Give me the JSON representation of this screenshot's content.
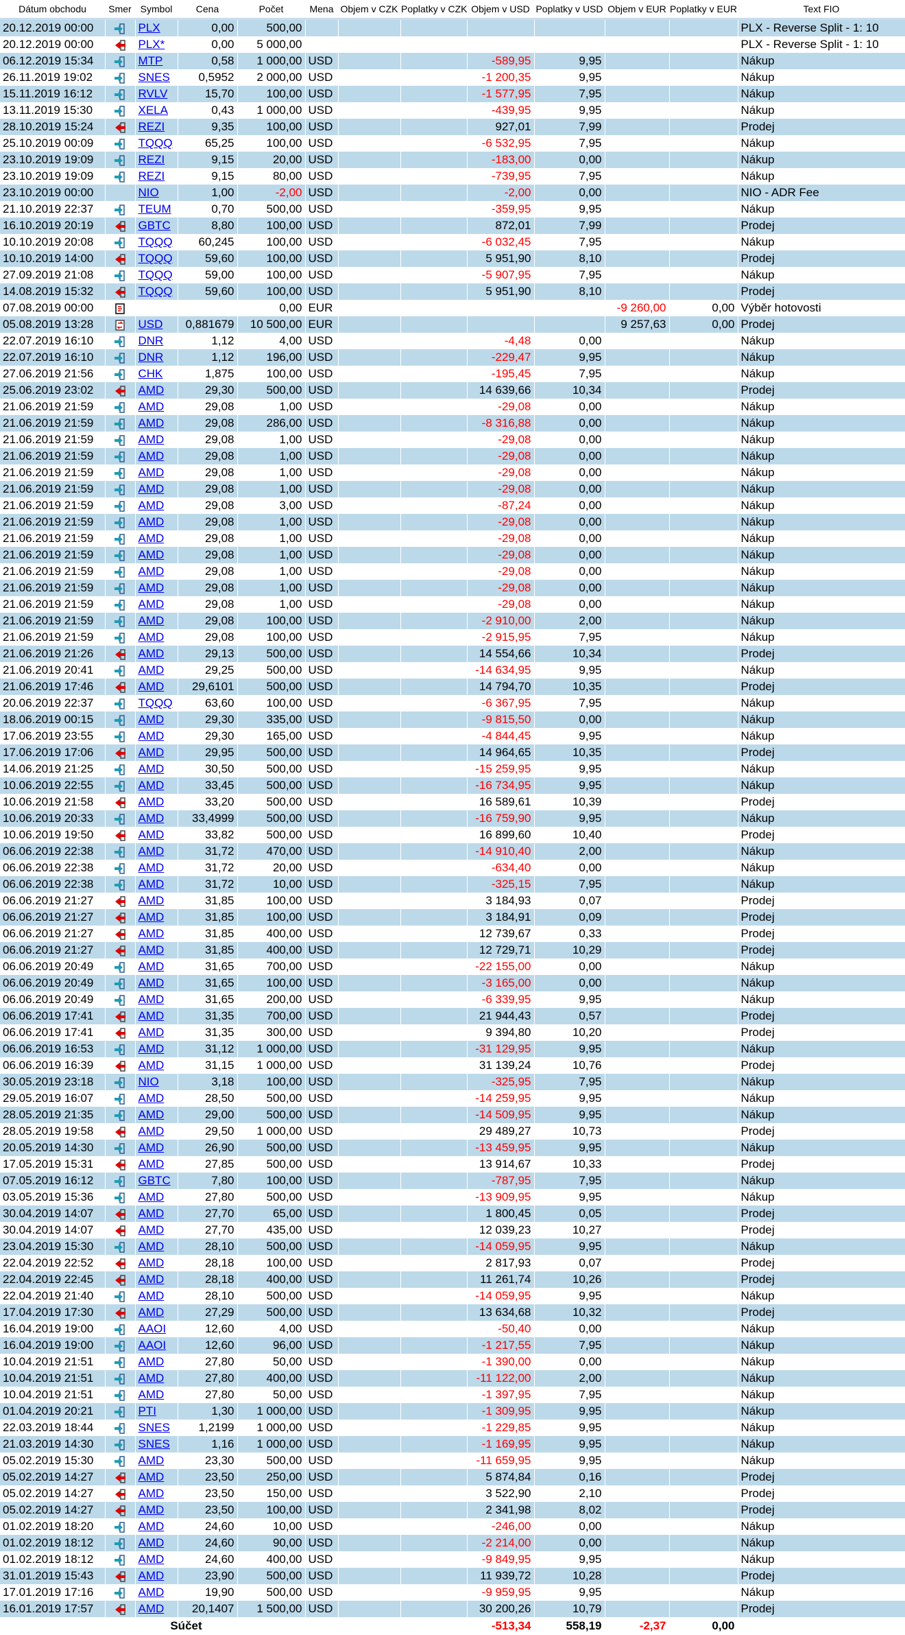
{
  "columns": [
    "Dátum obchodu",
    "Smer",
    "Symbol",
    "Cena",
    "Počet",
    "Mena",
    "Objem v CZK",
    "Poplatky v CZK",
    "Objem v USD",
    "Poplatky v USD",
    "Objem v EUR",
    "Poplatky v EUR",
    "Text FIO"
  ],
  "colors": {
    "row_stripe": "#bcd9ea",
    "negative": "#ff0000",
    "link": "#0000ee",
    "buy_icon": "#1f9bb5",
    "sell_icon": "#e00000"
  },
  "icons": {
    "buy": "arrow-in-icon",
    "sell": "arrow-out-icon",
    "withdraw": "withdrawal-icon",
    "fx": "currency-exchange-icon"
  },
  "rows": [
    [
      "20.12.2019 00:00",
      "buy",
      "PLX",
      "0,00",
      "500,00",
      "",
      "",
      "",
      "",
      "",
      "",
      "",
      "PLX - Reverse Split - 1: 10"
    ],
    [
      "20.12.2019 00:00",
      "sell",
      "PLX*",
      "0,00",
      "5 000,00",
      "",
      "",
      "",
      "",
      "",
      "",
      "",
      "PLX - Reverse Split - 1: 10"
    ],
    [
      "06.12.2019 15:34",
      "buy",
      "MTP",
      "0,58",
      "1 000,00",
      "USD",
      "",
      "",
      "-589,95",
      "9,95",
      "",
      "",
      "Nákup"
    ],
    [
      "26.11.2019 19:02",
      "buy",
      "SNES",
      "0,5952",
      "2 000,00",
      "USD",
      "",
      "",
      "-1 200,35",
      "9,95",
      "",
      "",
      "Nákup"
    ],
    [
      "15.11.2019 16:12",
      "buy",
      "RVLV",
      "15,70",
      "100,00",
      "USD",
      "",
      "",
      "-1 577,95",
      "7,95",
      "",
      "",
      "Nákup"
    ],
    [
      "13.11.2019 15:30",
      "buy",
      "XELA",
      "0,43",
      "1 000,00",
      "USD",
      "",
      "",
      "-439,95",
      "9,95",
      "",
      "",
      "Nákup"
    ],
    [
      "28.10.2019 15:24",
      "sell",
      "REZI",
      "9,35",
      "100,00",
      "USD",
      "",
      "",
      "927,01",
      "7,99",
      "",
      "",
      "Prodej"
    ],
    [
      "25.10.2019 00:09",
      "buy",
      "TQQQ",
      "65,25",
      "100,00",
      "USD",
      "",
      "",
      "-6 532,95",
      "7,95",
      "",
      "",
      "Nákup"
    ],
    [
      "23.10.2019 19:09",
      "buy",
      "REZI",
      "9,15",
      "20,00",
      "USD",
      "",
      "",
      "-183,00",
      "0,00",
      "",
      "",
      "Nákup"
    ],
    [
      "23.10.2019 19:09",
      "buy",
      "REZI",
      "9,15",
      "80,00",
      "USD",
      "",
      "",
      "-739,95",
      "7,95",
      "",
      "",
      "Nákup"
    ],
    [
      "23.10.2019 00:00",
      "",
      "NIO",
      "1,00",
      "-2,00",
      "USD",
      "",
      "",
      "-2,00",
      "0,00",
      "",
      "",
      "NIO - ADR Fee"
    ],
    [
      "21.10.2019 22:37",
      "buy",
      "TEUM",
      "0,70",
      "500,00",
      "USD",
      "",
      "",
      "-359,95",
      "9,95",
      "",
      "",
      "Nákup"
    ],
    [
      "16.10.2019 20:19",
      "sell",
      "GBTC",
      "8,80",
      "100,00",
      "USD",
      "",
      "",
      "872,01",
      "7,99",
      "",
      "",
      "Prodej"
    ],
    [
      "10.10.2019 20:08",
      "buy",
      "TQQQ",
      "60,245",
      "100,00",
      "USD",
      "",
      "",
      "-6 032,45",
      "7,95",
      "",
      "",
      "Nákup"
    ],
    [
      "10.10.2019 14:00",
      "sell",
      "TQQQ",
      "59,60",
      "100,00",
      "USD",
      "",
      "",
      "5 951,90",
      "8,10",
      "",
      "",
      "Prodej"
    ],
    [
      "27.09.2019 21:08",
      "buy",
      "TQQQ",
      "59,00",
      "100,00",
      "USD",
      "",
      "",
      "-5 907,95",
      "7,95",
      "",
      "",
      "Nákup"
    ],
    [
      "14.08.2019 15:32",
      "sell",
      "TQQQ",
      "59,60",
      "100,00",
      "USD",
      "",
      "",
      "5 951,90",
      "8,10",
      "",
      "",
      "Prodej"
    ],
    [
      "07.08.2019 00:00",
      "withdraw",
      "",
      "",
      "0,00",
      "EUR",
      "",
      "",
      "",
      "",
      "-9 260,00",
      "0,00",
      "Výběr hotovosti"
    ],
    [
      "05.08.2019 13:28",
      "fx",
      "USD",
      "0,881679",
      "10 500,00",
      "EUR",
      "",
      "",
      "",
      "",
      "9 257,63",
      "0,00",
      "Prodej"
    ],
    [
      "22.07.2019 16:10",
      "buy",
      "DNR",
      "1,12",
      "4,00",
      "USD",
      "",
      "",
      "-4,48",
      "0,00",
      "",
      "",
      "Nákup"
    ],
    [
      "22.07.2019 16:10",
      "buy",
      "DNR",
      "1,12",
      "196,00",
      "USD",
      "",
      "",
      "-229,47",
      "9,95",
      "",
      "",
      "Nákup"
    ],
    [
      "27.06.2019 21:56",
      "buy",
      "CHK",
      "1,875",
      "100,00",
      "USD",
      "",
      "",
      "-195,45",
      "7,95",
      "",
      "",
      "Nákup"
    ],
    [
      "25.06.2019 23:02",
      "sell",
      "AMD",
      "29,30",
      "500,00",
      "USD",
      "",
      "",
      "14 639,66",
      "10,34",
      "",
      "",
      "Prodej"
    ],
    [
      "21.06.2019 21:59",
      "buy",
      "AMD",
      "29,08",
      "1,00",
      "USD",
      "",
      "",
      "-29,08",
      "0,00",
      "",
      "",
      "Nákup"
    ],
    [
      "21.06.2019 21:59",
      "buy",
      "AMD",
      "29,08",
      "286,00",
      "USD",
      "",
      "",
      "-8 316,88",
      "0,00",
      "",
      "",
      "Nákup"
    ],
    [
      "21.06.2019 21:59",
      "buy",
      "AMD",
      "29,08",
      "1,00",
      "USD",
      "",
      "",
      "-29,08",
      "0,00",
      "",
      "",
      "Nákup"
    ],
    [
      "21.06.2019 21:59",
      "buy",
      "AMD",
      "29,08",
      "1,00",
      "USD",
      "",
      "",
      "-29,08",
      "0,00",
      "",
      "",
      "Nákup"
    ],
    [
      "21.06.2019 21:59",
      "buy",
      "AMD",
      "29,08",
      "1,00",
      "USD",
      "",
      "",
      "-29,08",
      "0,00",
      "",
      "",
      "Nákup"
    ],
    [
      "21.06.2019 21:59",
      "buy",
      "AMD",
      "29,08",
      "1,00",
      "USD",
      "",
      "",
      "-29,08",
      "0,00",
      "",
      "",
      "Nákup"
    ],
    [
      "21.06.2019 21:59",
      "buy",
      "AMD",
      "29,08",
      "3,00",
      "USD",
      "",
      "",
      "-87,24",
      "0,00",
      "",
      "",
      "Nákup"
    ],
    [
      "21.06.2019 21:59",
      "buy",
      "AMD",
      "29,08",
      "1,00",
      "USD",
      "",
      "",
      "-29,08",
      "0,00",
      "",
      "",
      "Nákup"
    ],
    [
      "21.06.2019 21:59",
      "buy",
      "AMD",
      "29,08",
      "1,00",
      "USD",
      "",
      "",
      "-29,08",
      "0,00",
      "",
      "",
      "Nákup"
    ],
    [
      "21.06.2019 21:59",
      "buy",
      "AMD",
      "29,08",
      "1,00",
      "USD",
      "",
      "",
      "-29,08",
      "0,00",
      "",
      "",
      "Nákup"
    ],
    [
      "21.06.2019 21:59",
      "buy",
      "AMD",
      "29,08",
      "1,00",
      "USD",
      "",
      "",
      "-29,08",
      "0,00",
      "",
      "",
      "Nákup"
    ],
    [
      "21.06.2019 21:59",
      "buy",
      "AMD",
      "29,08",
      "1,00",
      "USD",
      "",
      "",
      "-29,08",
      "0,00",
      "",
      "",
      "Nákup"
    ],
    [
      "21.06.2019 21:59",
      "buy",
      "AMD",
      "29,08",
      "1,00",
      "USD",
      "",
      "",
      "-29,08",
      "0,00",
      "",
      "",
      "Nákup"
    ],
    [
      "21.06.2019 21:59",
      "buy",
      "AMD",
      "29,08",
      "100,00",
      "USD",
      "",
      "",
      "-2 910,00",
      "2,00",
      "",
      "",
      "Nákup"
    ],
    [
      "21.06.2019 21:59",
      "buy",
      "AMD",
      "29,08",
      "100,00",
      "USD",
      "",
      "",
      "-2 915,95",
      "7,95",
      "",
      "",
      "Nákup"
    ],
    [
      "21.06.2019 21:26",
      "sell",
      "AMD",
      "29,13",
      "500,00",
      "USD",
      "",
      "",
      "14 554,66",
      "10,34",
      "",
      "",
      "Prodej"
    ],
    [
      "21.06.2019 20:41",
      "buy",
      "AMD",
      "29,25",
      "500,00",
      "USD",
      "",
      "",
      "-14 634,95",
      "9,95",
      "",
      "",
      "Nákup"
    ],
    [
      "21.06.2019 17:46",
      "sell",
      "AMD",
      "29,6101",
      "500,00",
      "USD",
      "",
      "",
      "14 794,70",
      "10,35",
      "",
      "",
      "Prodej"
    ],
    [
      "20.06.2019 22:37",
      "buy",
      "TQQQ",
      "63,60",
      "100,00",
      "USD",
      "",
      "",
      "-6 367,95",
      "7,95",
      "",
      "",
      "Nákup"
    ],
    [
      "18.06.2019 00:15",
      "buy",
      "AMD",
      "29,30",
      "335,00",
      "USD",
      "",
      "",
      "-9 815,50",
      "0,00",
      "",
      "",
      "Nákup"
    ],
    [
      "17.06.2019 23:55",
      "buy",
      "AMD",
      "29,30",
      "165,00",
      "USD",
      "",
      "",
      "-4 844,45",
      "9,95",
      "",
      "",
      "Nákup"
    ],
    [
      "17.06.2019 17:06",
      "sell",
      "AMD",
      "29,95",
      "500,00",
      "USD",
      "",
      "",
      "14 964,65",
      "10,35",
      "",
      "",
      "Prodej"
    ],
    [
      "14.06.2019 21:25",
      "buy",
      "AMD",
      "30,50",
      "500,00",
      "USD",
      "",
      "",
      "-15 259,95",
      "9,95",
      "",
      "",
      "Nákup"
    ],
    [
      "10.06.2019 22:55",
      "buy",
      "AMD",
      "33,45",
      "500,00",
      "USD",
      "",
      "",
      "-16 734,95",
      "9,95",
      "",
      "",
      "Nákup"
    ],
    [
      "10.06.2019 21:58",
      "sell",
      "AMD",
      "33,20",
      "500,00",
      "USD",
      "",
      "",
      "16 589,61",
      "10,39",
      "",
      "",
      "Prodej"
    ],
    [
      "10.06.2019 20:33",
      "buy",
      "AMD",
      "33,4999",
      "500,00",
      "USD",
      "",
      "",
      "-16 759,90",
      "9,95",
      "",
      "",
      "Nákup"
    ],
    [
      "10.06.2019 19:50",
      "sell",
      "AMD",
      "33,82",
      "500,00",
      "USD",
      "",
      "",
      "16 899,60",
      "10,40",
      "",
      "",
      "Prodej"
    ],
    [
      "06.06.2019 22:38",
      "buy",
      "AMD",
      "31,72",
      "470,00",
      "USD",
      "",
      "",
      "-14 910,40",
      "2,00",
      "",
      "",
      "Nákup"
    ],
    [
      "06.06.2019 22:38",
      "buy",
      "AMD",
      "31,72",
      "20,00",
      "USD",
      "",
      "",
      "-634,40",
      "0,00",
      "",
      "",
      "Nákup"
    ],
    [
      "06.06.2019 22:38",
      "buy",
      "AMD",
      "31,72",
      "10,00",
      "USD",
      "",
      "",
      "-325,15",
      "7,95",
      "",
      "",
      "Nákup"
    ],
    [
      "06.06.2019 21:27",
      "sell",
      "AMD",
      "31,85",
      "100,00",
      "USD",
      "",
      "",
      "3 184,93",
      "0,07",
      "",
      "",
      "Prodej"
    ],
    [
      "06.06.2019 21:27",
      "sell",
      "AMD",
      "31,85",
      "100,00",
      "USD",
      "",
      "",
      "3 184,91",
      "0,09",
      "",
      "",
      "Prodej"
    ],
    [
      "06.06.2019 21:27",
      "sell",
      "AMD",
      "31,85",
      "400,00",
      "USD",
      "",
      "",
      "12 739,67",
      "0,33",
      "",
      "",
      "Prodej"
    ],
    [
      "06.06.2019 21:27",
      "sell",
      "AMD",
      "31,85",
      "400,00",
      "USD",
      "",
      "",
      "12 729,71",
      "10,29",
      "",
      "",
      "Prodej"
    ],
    [
      "06.06.2019 20:49",
      "buy",
      "AMD",
      "31,65",
      "700,00",
      "USD",
      "",
      "",
      "-22 155,00",
      "0,00",
      "",
      "",
      "Nákup"
    ],
    [
      "06.06.2019 20:49",
      "buy",
      "AMD",
      "31,65",
      "100,00",
      "USD",
      "",
      "",
      "-3 165,00",
      "0,00",
      "",
      "",
      "Nákup"
    ],
    [
      "06.06.2019 20:49",
      "buy",
      "AMD",
      "31,65",
      "200,00",
      "USD",
      "",
      "",
      "-6 339,95",
      "9,95",
      "",
      "",
      "Nákup"
    ],
    [
      "06.06.2019 17:41",
      "sell",
      "AMD",
      "31,35",
      "700,00",
      "USD",
      "",
      "",
      "21 944,43",
      "0,57",
      "",
      "",
      "Prodej"
    ],
    [
      "06.06.2019 17:41",
      "sell",
      "AMD",
      "31,35",
      "300,00",
      "USD",
      "",
      "",
      "9 394,80",
      "10,20",
      "",
      "",
      "Prodej"
    ],
    [
      "06.06.2019 16:53",
      "buy",
      "AMD",
      "31,12",
      "1 000,00",
      "USD",
      "",
      "",
      "-31 129,95",
      "9,95",
      "",
      "",
      "Nákup"
    ],
    [
      "06.06.2019 16:39",
      "sell",
      "AMD",
      "31,15",
      "1 000,00",
      "USD",
      "",
      "",
      "31 139,24",
      "10,76",
      "",
      "",
      "Prodej"
    ],
    [
      "30.05.2019 23:18",
      "buy",
      "NIO",
      "3,18",
      "100,00",
      "USD",
      "",
      "",
      "-325,95",
      "7,95",
      "",
      "",
      "Nákup"
    ],
    [
      "29.05.2019 16:07",
      "buy",
      "AMD",
      "28,50",
      "500,00",
      "USD",
      "",
      "",
      "-14 259,95",
      "9,95",
      "",
      "",
      "Nákup"
    ],
    [
      "28.05.2019 21:35",
      "buy",
      "AMD",
      "29,00",
      "500,00",
      "USD",
      "",
      "",
      "-14 509,95",
      "9,95",
      "",
      "",
      "Nákup"
    ],
    [
      "28.05.2019 19:58",
      "sell",
      "AMD",
      "29,50",
      "1 000,00",
      "USD",
      "",
      "",
      "29 489,27",
      "10,73",
      "",
      "",
      "Prodej"
    ],
    [
      "20.05.2019 14:30",
      "buy",
      "AMD",
      "26,90",
      "500,00",
      "USD",
      "",
      "",
      "-13 459,95",
      "9,95",
      "",
      "",
      "Nákup"
    ],
    [
      "17.05.2019 15:31",
      "sell",
      "AMD",
      "27,85",
      "500,00",
      "USD",
      "",
      "",
      "13 914,67",
      "10,33",
      "",
      "",
      "Prodej"
    ],
    [
      "07.05.2019 16:12",
      "buy",
      "GBTC",
      "7,80",
      "100,00",
      "USD",
      "",
      "",
      "-787,95",
      "7,95",
      "",
      "",
      "Nákup"
    ],
    [
      "03.05.2019 15:36",
      "buy",
      "AMD",
      "27,80",
      "500,00",
      "USD",
      "",
      "",
      "-13 909,95",
      "9,95",
      "",
      "",
      "Nákup"
    ],
    [
      "30.04.2019 14:07",
      "sell",
      "AMD",
      "27,70",
      "65,00",
      "USD",
      "",
      "",
      "1 800,45",
      "0,05",
      "",
      "",
      "Prodej"
    ],
    [
      "30.04.2019 14:07",
      "sell",
      "AMD",
      "27,70",
      "435,00",
      "USD",
      "",
      "",
      "12 039,23",
      "10,27",
      "",
      "",
      "Prodej"
    ],
    [
      "23.04.2019 15:30",
      "buy",
      "AMD",
      "28,10",
      "500,00",
      "USD",
      "",
      "",
      "-14 059,95",
      "9,95",
      "",
      "",
      "Nákup"
    ],
    [
      "22.04.2019 22:52",
      "sell",
      "AMD",
      "28,18",
      "100,00",
      "USD",
      "",
      "",
      "2 817,93",
      "0,07",
      "",
      "",
      "Prodej"
    ],
    [
      "22.04.2019 22:45",
      "sell",
      "AMD",
      "28,18",
      "400,00",
      "USD",
      "",
      "",
      "11 261,74",
      "10,26",
      "",
      "",
      "Prodej"
    ],
    [
      "22.04.2019 21:40",
      "buy",
      "AMD",
      "28,10",
      "500,00",
      "USD",
      "",
      "",
      "-14 059,95",
      "9,95",
      "",
      "",
      "Nákup"
    ],
    [
      "17.04.2019 17:30",
      "sell",
      "AMD",
      "27,29",
      "500,00",
      "USD",
      "",
      "",
      "13 634,68",
      "10,32",
      "",
      "",
      "Prodej"
    ],
    [
      "16.04.2019 19:00",
      "buy",
      "AAOI",
      "12,60",
      "4,00",
      "USD",
      "",
      "",
      "-50,40",
      "0,00",
      "",
      "",
      "Nákup"
    ],
    [
      "16.04.2019 19:00",
      "buy",
      "AAOI",
      "12,60",
      "96,00",
      "USD",
      "",
      "",
      "-1 217,55",
      "7,95",
      "",
      "",
      "Nákup"
    ],
    [
      "10.04.2019 21:51",
      "buy",
      "AMD",
      "27,80",
      "50,00",
      "USD",
      "",
      "",
      "-1 390,00",
      "0,00",
      "",
      "",
      "Nákup"
    ],
    [
      "10.04.2019 21:51",
      "buy",
      "AMD",
      "27,80",
      "400,00",
      "USD",
      "",
      "",
      "-11 122,00",
      "2,00",
      "",
      "",
      "Nákup"
    ],
    [
      "10.04.2019 21:51",
      "buy",
      "AMD",
      "27,80",
      "50,00",
      "USD",
      "",
      "",
      "-1 397,95",
      "7,95",
      "",
      "",
      "Nákup"
    ],
    [
      "01.04.2019 20:21",
      "buy",
      "PTI",
      "1,30",
      "1 000,00",
      "USD",
      "",
      "",
      "-1 309,95",
      "9,95",
      "",
      "",
      "Nákup"
    ],
    [
      "22.03.2019 18:44",
      "buy",
      "SNES",
      "1,2199",
      "1 000,00",
      "USD",
      "",
      "",
      "-1 229,85",
      "9,95",
      "",
      "",
      "Nákup"
    ],
    [
      "21.03.2019 14:30",
      "buy",
      "SNES",
      "1,16",
      "1 000,00",
      "USD",
      "",
      "",
      "-1 169,95",
      "9,95",
      "",
      "",
      "Nákup"
    ],
    [
      "05.02.2019 15:30",
      "buy",
      "AMD",
      "23,30",
      "500,00",
      "USD",
      "",
      "",
      "-11 659,95",
      "9,95",
      "",
      "",
      "Nákup"
    ],
    [
      "05.02.2019 14:27",
      "sell",
      "AMD",
      "23,50",
      "250,00",
      "USD",
      "",
      "",
      "5 874,84",
      "0,16",
      "",
      "",
      "Prodej"
    ],
    [
      "05.02.2019 14:27",
      "sell",
      "AMD",
      "23,50",
      "150,00",
      "USD",
      "",
      "",
      "3 522,90",
      "2,10",
      "",
      "",
      "Prodej"
    ],
    [
      "05.02.2019 14:27",
      "sell",
      "AMD",
      "23,50",
      "100,00",
      "USD",
      "",
      "",
      "2 341,98",
      "8,02",
      "",
      "",
      "Prodej"
    ],
    [
      "01.02.2019 18:20",
      "buy",
      "AMD",
      "24,60",
      "10,00",
      "USD",
      "",
      "",
      "-246,00",
      "0,00",
      "",
      "",
      "Nákup"
    ],
    [
      "01.02.2019 18:12",
      "buy",
      "AMD",
      "24,60",
      "90,00",
      "USD",
      "",
      "",
      "-2 214,00",
      "0,00",
      "",
      "",
      "Nákup"
    ],
    [
      "01.02.2019 18:12",
      "buy",
      "AMD",
      "24,60",
      "400,00",
      "USD",
      "",
      "",
      "-9 849,95",
      "9,95",
      "",
      "",
      "Nákup"
    ],
    [
      "31.01.2019 15:43",
      "sell",
      "AMD",
      "23,90",
      "500,00",
      "USD",
      "",
      "",
      "11 939,72",
      "10,28",
      "",
      "",
      "Prodej"
    ],
    [
      "17.01.2019 17:16",
      "buy",
      "AMD",
      "19,90",
      "500,00",
      "USD",
      "",
      "",
      "-9 959,95",
      "9,95",
      "",
      "",
      "Nákup"
    ],
    [
      "16.01.2019 17:57",
      "sell",
      "AMD",
      "20,1407",
      "1 500,00",
      "USD",
      "",
      "",
      "30 200,26",
      "10,79",
      "",
      "",
      "Prodej"
    ]
  ],
  "footer": {
    "label": "Súčet",
    "usd_volume": "-513,34",
    "usd_fees": "558,19",
    "eur_volume": "-2,37",
    "eur_fees": "0,00"
  }
}
